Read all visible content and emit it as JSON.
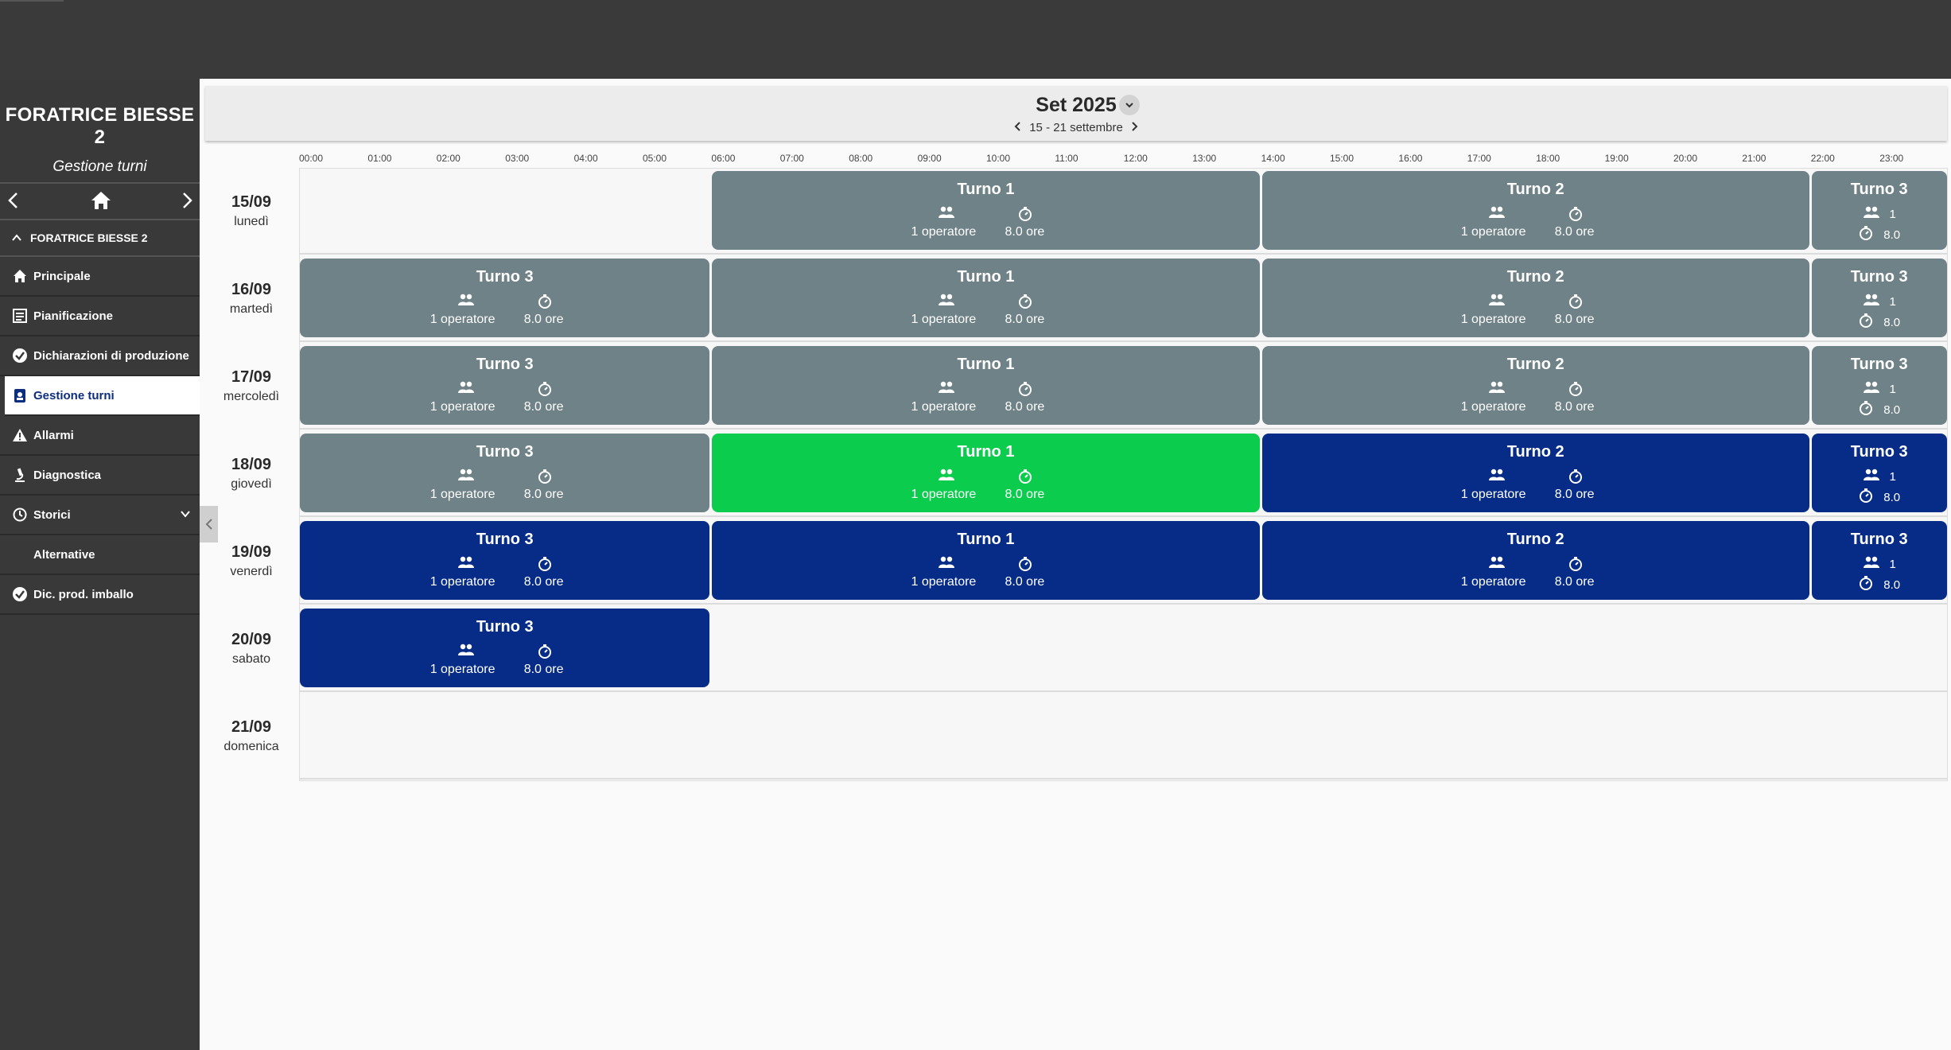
{
  "app": {
    "title": "FORATRICE BIESSE 2",
    "subtitle": "Gestione turni"
  },
  "sidebar": {
    "section": "FORATRICE BIESSE 2",
    "items": [
      {
        "label": "Principale",
        "icon": "home-icon"
      },
      {
        "label": "Pianificazione",
        "icon": "list-icon"
      },
      {
        "label": "Dichiarazioni di produzione",
        "icon": "check-badge-icon"
      },
      {
        "label": "Gestione turni",
        "icon": "badge-icon",
        "active": true
      },
      {
        "label": "Allarmi",
        "icon": "warning-icon"
      },
      {
        "label": "Diagnostica",
        "icon": "microscope-icon"
      },
      {
        "label": "Storici",
        "icon": "history-icon"
      },
      {
        "label": "Alternative",
        "icon": ""
      },
      {
        "label": "Dic. prod. imballo",
        "icon": "check-badge-icon"
      }
    ]
  },
  "header": {
    "month": "Set 2025",
    "week_range": "15 - 21 settembre"
  },
  "hours": [
    "00:00",
    "01:00",
    "02:00",
    "03:00",
    "04:00",
    "05:00",
    "06:00",
    "07:00",
    "08:00",
    "09:00",
    "10:00",
    "11:00",
    "12:00",
    "13:00",
    "14:00",
    "15:00",
    "16:00",
    "17:00",
    "18:00",
    "19:00",
    "20:00",
    "21:00",
    "22:00",
    "23:00"
  ],
  "days": [
    {
      "date": "15/09",
      "name": "lunedì"
    },
    {
      "date": "16/09",
      "name": "martedì"
    },
    {
      "date": "17/09",
      "name": "mercoledì"
    },
    {
      "date": "18/09",
      "name": "giovedì"
    },
    {
      "date": "19/09",
      "name": "venerdì"
    },
    {
      "date": "20/09",
      "name": "sabato"
    },
    {
      "date": "21/09",
      "name": "domenica"
    }
  ],
  "shift_labels": {
    "turno1": "Turno 1",
    "turno2": "Turno 2",
    "turno3": "Turno 3",
    "operators": "1 operatore",
    "hours": "8.0 ore",
    "operators_short": "1",
    "hours_short": "8.0"
  },
  "colors": {
    "past": "#6f8287",
    "current": "#0ccc4e",
    "future": "#062c88",
    "sidebar_bg": "#393939",
    "topbar_bg": "#3a3a3a"
  }
}
